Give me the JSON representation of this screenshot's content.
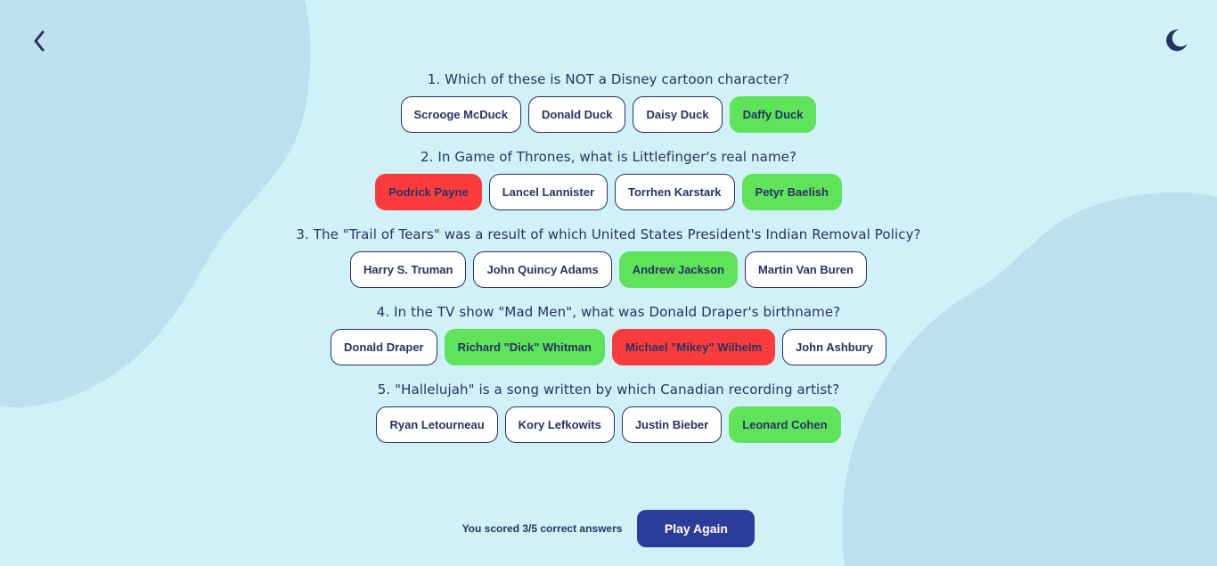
{
  "colors": {
    "background": "#d1f1f8",
    "blob": "#bedfee",
    "text": "#293264",
    "correct": "#5fe35a",
    "wrong": "#fc3c3c",
    "button": "#2e3c99"
  },
  "header": {
    "back_icon": "chevron-left-icon",
    "theme_icon": "moon-icon"
  },
  "questions": [
    {
      "text": "1. Which of these is NOT a Disney cartoon character?",
      "answers": [
        {
          "label": "Scrooge McDuck",
          "state": "none"
        },
        {
          "label": "Donald Duck",
          "state": "none"
        },
        {
          "label": "Daisy Duck",
          "state": "none"
        },
        {
          "label": "Daffy Duck",
          "state": "correct"
        }
      ]
    },
    {
      "text": "2. In Game of Thrones, what is Littlefinger's real name?",
      "answers": [
        {
          "label": "Podrick Payne",
          "state": "wrong"
        },
        {
          "label": "Lancel Lannister",
          "state": "none"
        },
        {
          "label": "Torrhen Karstark",
          "state": "none"
        },
        {
          "label": "Petyr Baelish",
          "state": "correct"
        }
      ]
    },
    {
      "text": "3. The \"Trail of Tears\" was a result of which United States President's Indian Removal Policy?",
      "answers": [
        {
          "label": "Harry S. Truman",
          "state": "none"
        },
        {
          "label": "John Quincy Adams",
          "state": "none"
        },
        {
          "label": "Andrew Jackson",
          "state": "correct"
        },
        {
          "label": "Martin Van Buren",
          "state": "none"
        }
      ]
    },
    {
      "text": "4. In the TV show \"Mad Men\", what was Donald Draper's birthname?",
      "answers": [
        {
          "label": "Donald Draper",
          "state": "none"
        },
        {
          "label": "Richard \"Dick\" Whitman",
          "state": "correct"
        },
        {
          "label": "Michael \"Mikey\" Wilhelm",
          "state": "wrong"
        },
        {
          "label": "John Ashbury",
          "state": "none"
        }
      ]
    },
    {
      "text": "5. \"Hallelujah\" is a song written by which Canadian recording artist?",
      "answers": [
        {
          "label": "Ryan Letourneau",
          "state": "none"
        },
        {
          "label": "Kory Lefkowits",
          "state": "none"
        },
        {
          "label": "Justin Bieber",
          "state": "none"
        },
        {
          "label": "Leonard Cohen",
          "state": "correct"
        }
      ]
    }
  ],
  "footer": {
    "score_text": "You scored 3/5 correct answers",
    "play_again_label": "Play Again"
  }
}
